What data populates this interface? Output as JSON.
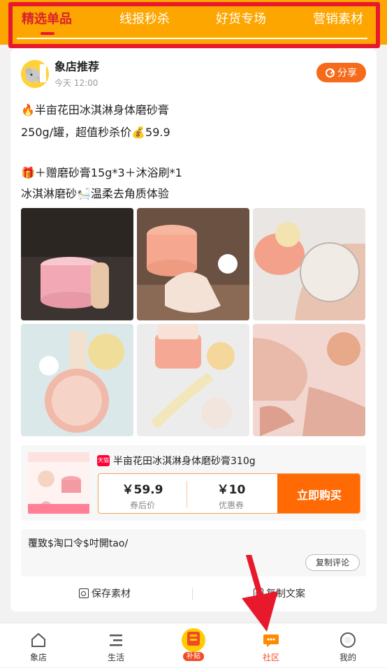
{
  "tabs": [
    {
      "label": "精选单品",
      "active": true
    },
    {
      "label": "线报秒杀",
      "active": false
    },
    {
      "label": "好货专场",
      "active": false
    },
    {
      "label": "营销素材",
      "active": false
    }
  ],
  "post": {
    "shop_name": "象店推荐",
    "time": "今天 12:00",
    "share_label": "分享",
    "lines": [
      "🔥半亩花田冰淇淋身体磨砂膏",
      "250g/罐，超值秒杀价💰59.9",
      "🎁＋赠磨砂膏15g*3＋沐浴刷*1",
      "冰淇淋磨砂🛀温柔去角质体验"
    ]
  },
  "product": {
    "badge": "天猫",
    "title": "半亩花田冰淇淋身体磨砂膏310g",
    "price_value": "￥59.9",
    "price_label": "券后价",
    "coupon_value": "￥10",
    "coupon_label": "优惠券",
    "buy_label": "立即购买"
  },
  "token": {
    "text": "覆致$淘口令$吋開tao/",
    "copy_comment_label": "复制评论"
  },
  "actions": {
    "save_label": "保存素材",
    "copy_label": "复制文案"
  },
  "bottom_nav": [
    {
      "label": "象店",
      "icon": "home-icon"
    },
    {
      "label": "生活",
      "icon": "list-icon"
    },
    {
      "label": "补贴",
      "icon": "subsidy-icon"
    },
    {
      "label": "社区",
      "icon": "community-icon",
      "active": true
    },
    {
      "label": "我的",
      "icon": "profile-icon"
    }
  ],
  "colors": {
    "topbar": "#fda600",
    "highlight": "#e8192c",
    "accent": "#ff6a05",
    "share": "#f56b1b"
  }
}
